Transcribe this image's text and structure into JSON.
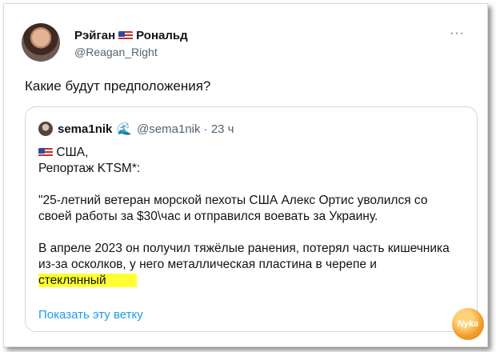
{
  "author": {
    "name_first": "Рэйган",
    "flag_icon": "us-flag-icon",
    "name_last": "Рональд",
    "handle": "@Reagan_Right"
  },
  "more_label": "···",
  "tweet": {
    "text": "Какие будут предположения?"
  },
  "quote": {
    "name": "sema1nik",
    "badge_icon": "wave-icon",
    "badge_glyph": "🌊",
    "handle_time": "@sema1nik · 23 ч",
    "country": "США,",
    "report": "Репортаж KTSM*:",
    "p1": "\"25-летний ветеран морской пехоты США Алекс Ортис уволился со своей работы за $30\\час и отправился воевать за Украину.",
    "p2_main": "В апреле 2023 он получил тяжёлые ранения, потерял часть кишечника из-за осколков, у него металлическая пластина в черепе и",
    "p2_highlight": "стеклянный",
    "show_thread": "Показать эту ветку"
  },
  "watermark": {
    "text": "Nyka"
  },
  "colors": {
    "link": "#1d9bf0",
    "highlight": "#ffff33",
    "secondary_text": "#536471"
  }
}
